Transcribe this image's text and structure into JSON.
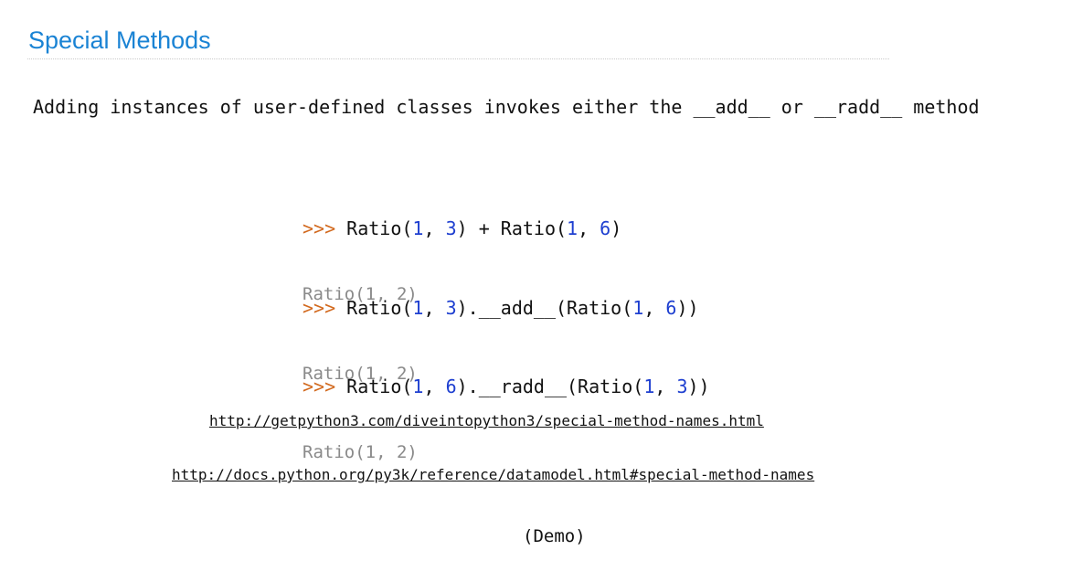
{
  "title": "Special Methods",
  "intro": "Adding instances of user-defined classes invokes either the __add__ or __radd__ method",
  "examples": [
    {
      "prompt": ">>>",
      "input_parts": [
        " Ratio(",
        "1",
        ", ",
        "3",
        ") + Ratio(",
        "1",
        ", ",
        "6",
        ")"
      ],
      "output": "Ratio(1, 2)"
    },
    {
      "prompt": ">>>",
      "input_parts": [
        " Ratio(",
        "1",
        ", ",
        "3",
        ").__add__(Ratio(",
        "1",
        ", ",
        "6",
        "))"
      ],
      "output": "Ratio(1, 2)"
    },
    {
      "prompt": ">>>",
      "input_parts": [
        " Ratio(",
        "1",
        ", ",
        "6",
        ").__radd__(Ratio(",
        "1",
        ", ",
        "3",
        "))"
      ],
      "output": "Ratio(1, 2)"
    }
  ],
  "links": [
    "http://getpython3.com/diveintopython3/special-method-names.html",
    "http://docs.python.org/py3k/reference/datamodel.html#special-method-names"
  ],
  "demo_label": "(Demo)",
  "colors": {
    "title": "#1a83d4",
    "prompt": "#d2691e",
    "number": "#1e3fd0",
    "output": "#8a8a8a"
  }
}
